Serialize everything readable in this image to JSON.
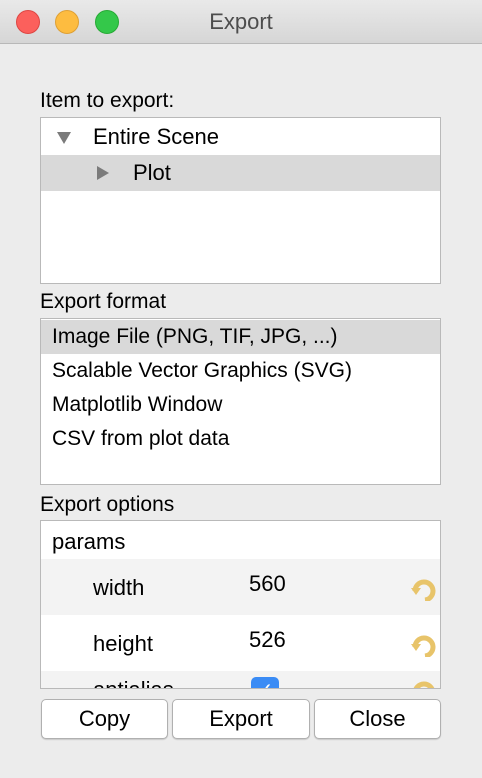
{
  "window": {
    "title": "Export"
  },
  "item_section": {
    "label": "Item to export:",
    "tree": [
      {
        "label": "Entire Scene",
        "expanded": true,
        "selected": false
      },
      {
        "label": "Plot",
        "expanded": false,
        "selected": true
      }
    ]
  },
  "format_section": {
    "label": "Export format",
    "items": [
      {
        "label": "Image File (PNG, TIF, JPG, ...)",
        "selected": true
      },
      {
        "label": "Scalable Vector Graphics (SVG)",
        "selected": false
      },
      {
        "label": "Matplotlib Window",
        "selected": false
      },
      {
        "label": "CSV from plot data",
        "selected": false
      }
    ]
  },
  "options_section": {
    "label": "Export options",
    "group": "params",
    "params": [
      {
        "name": "width",
        "value": "560"
      },
      {
        "name": "height",
        "value": "526"
      },
      {
        "name": "antialias",
        "checked": true
      }
    ]
  },
  "buttons": {
    "copy": "Copy",
    "export": "Export",
    "close": "Close"
  },
  "colors": {
    "selection": "#d9d9d9",
    "checkbox": "#3b8cf5",
    "reset_icon": "#e8c46a"
  }
}
